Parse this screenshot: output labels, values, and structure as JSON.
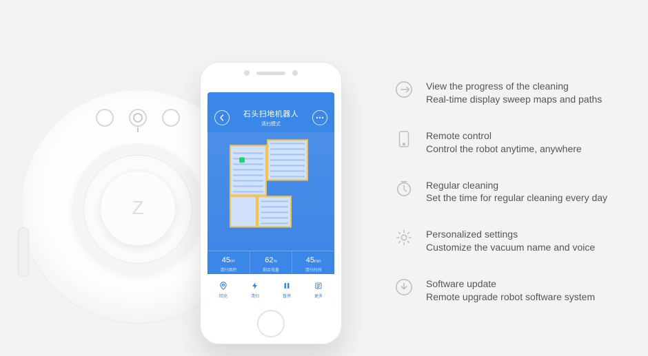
{
  "phone": {
    "status": {
      "left": "",
      "right": ""
    },
    "header": {
      "title": "石头扫地机器人",
      "subtitle": "清扫模式"
    },
    "stats": [
      {
        "value": "45",
        "unit": "m²",
        "label": "清扫面积"
      },
      {
        "value": "62",
        "unit": "%",
        "label": "剩余电量"
      },
      {
        "value": "45",
        "unit": "min",
        "label": "清扫时间"
      }
    ],
    "bottom": [
      {
        "label": "回充"
      },
      {
        "label": "清扫"
      },
      {
        "label": "暂停"
      },
      {
        "label": "更多"
      }
    ]
  },
  "features": [
    {
      "icon": "progress-icon",
      "title": "View the progress of the cleaning",
      "desc": "Real-time display sweep maps and paths"
    },
    {
      "icon": "remote-icon",
      "title": "Remote control",
      "desc": "Control  the robot anytime, anywhere"
    },
    {
      "icon": "clock-icon",
      "title": "Regular cleaning",
      "desc": "Set the time for regular cleaning every day"
    },
    {
      "icon": "gear-icon",
      "title": "Personalized settings",
      "desc": "Customize the vacuum name and voice"
    },
    {
      "icon": "download-icon",
      "title": "Software update",
      "desc": "Remote upgrade robot software system"
    }
  ]
}
